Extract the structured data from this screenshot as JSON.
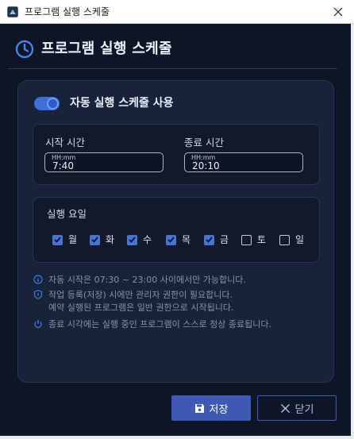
{
  "window": {
    "title": "프로그램 실행 스케줄",
    "app_icon": "app-icon",
    "close_icon": "close-icon"
  },
  "header": {
    "icon": "clock-icon",
    "title": "프로그램 실행 스케줄"
  },
  "toggle": {
    "label": "자동 실행 스케줄 사용",
    "enabled": true
  },
  "time": {
    "start_label": "시작 시간",
    "start_hint": "HH:mm",
    "start_value": "7:40",
    "end_label": "종료 시간",
    "end_hint": "HH:mm",
    "end_value": "20:10"
  },
  "days": {
    "title": "실행 요일",
    "items": [
      {
        "label": "월",
        "checked": true
      },
      {
        "label": "화",
        "checked": true
      },
      {
        "label": "수",
        "checked": true
      },
      {
        "label": "목",
        "checked": true
      },
      {
        "label": "금",
        "checked": true
      },
      {
        "label": "토",
        "checked": false
      },
      {
        "label": "일",
        "checked": false
      }
    ]
  },
  "info": {
    "line1": "자동 시작은 07:30 ~ 23:00 사이에서만 가능합니다.",
    "line2a": "작업 등록(저장) 시에만 관리자 권한이 필요합니다.",
    "line2b": "예약 실행된 프로그램은 일반 권한으로 시작됩니다.",
    "line3": "종료 시각에는 실행 중인 프로그램이 스스로 정상 종료됩니다.",
    "icons": [
      "info-circle-icon",
      "shield-icon",
      "power-icon"
    ]
  },
  "buttons": {
    "save_label": "저장",
    "save_icon": "floppy-disk-icon",
    "close_label": "닫기",
    "close_icon": "x-icon"
  },
  "colors": {
    "background": "#0d1626",
    "panel": "#18233a",
    "accent": "#3d59b4",
    "checkbox": "#4a73d6",
    "info_icon": "#3e7be0"
  }
}
